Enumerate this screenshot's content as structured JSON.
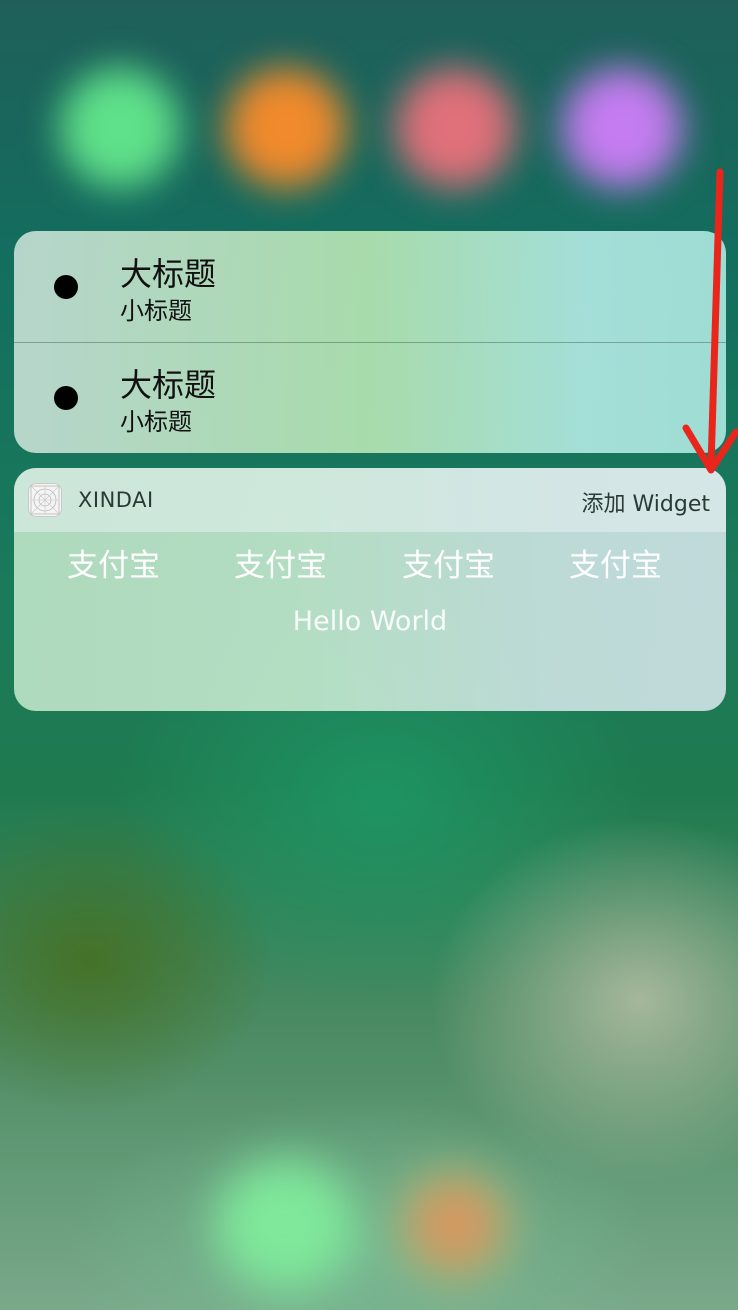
{
  "list_widget": {
    "rows": [
      {
        "title": "大标题",
        "subtitle": "小标题"
      },
      {
        "title": "大标题",
        "subtitle": "小标题"
      }
    ]
  },
  "app_widget": {
    "app_name": "XINDAI",
    "add_widget_label": "添加 Widget",
    "buttons": [
      "支付宝",
      "支付宝",
      "支付宝",
      "支付宝"
    ],
    "message": "Hello World"
  },
  "icons": {
    "bullet": "bullet-dot-icon",
    "app": "app-placeholder-icon",
    "annotation": "red-arrow-icon"
  },
  "colors": {
    "annotation_arrow": "#e8261c",
    "bullet": "#000000"
  }
}
